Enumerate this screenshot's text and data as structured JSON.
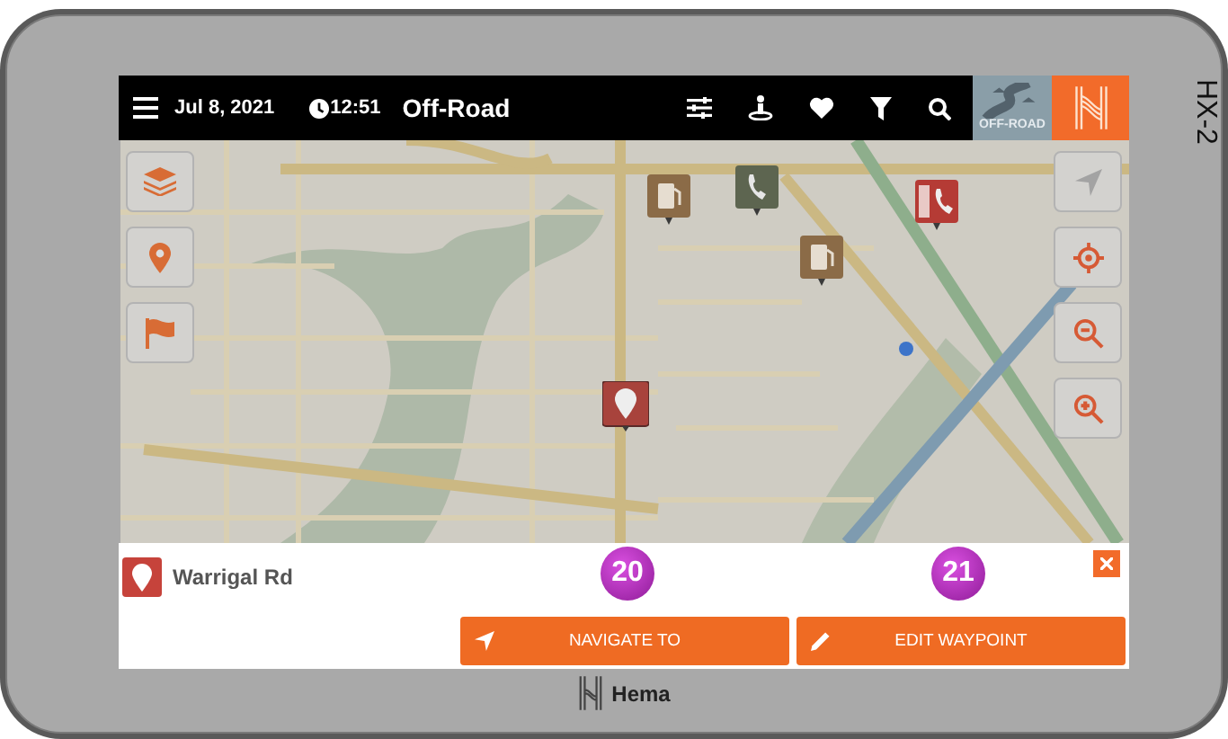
{
  "device": {
    "model": "HX-2",
    "brand": "Hema"
  },
  "top_bar": {
    "date": "Jul 8, 2021",
    "time": "12:51",
    "title": "Off-Road",
    "mode_tile": {
      "label": "OFF-ROAD"
    }
  },
  "location_panel": {
    "name": "Warrigal Rd",
    "buttons": [
      {
        "label": "NAVIGATE TO",
        "kind": "navigate"
      },
      {
        "label": "EDIT WAYPOINT",
        "kind": "edit"
      }
    ]
  },
  "callouts": [
    "20",
    "21"
  ]
}
